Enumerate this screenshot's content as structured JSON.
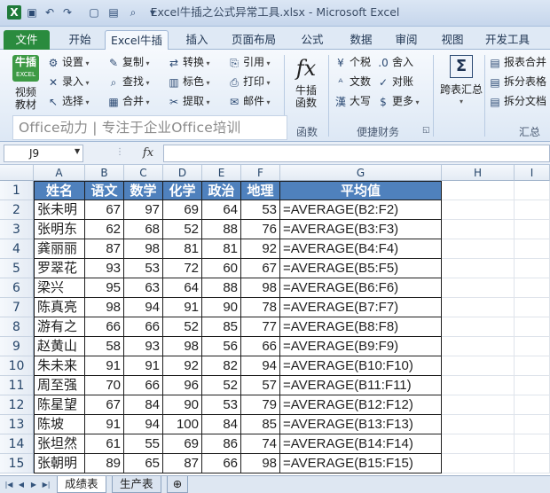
{
  "window": {
    "title": "Excel牛插之公式异常工具.xlsx - Microsoft Excel"
  },
  "quick_access": [
    {
      "icon": "excel-logo-icon",
      "glyph": "X"
    },
    {
      "icon": "save-icon",
      "glyph": "▣"
    },
    {
      "icon": "undo-icon",
      "glyph": "↶"
    },
    {
      "icon": "redo-icon",
      "glyph": "↷"
    },
    {
      "icon": "new-file-icon",
      "glyph": "▢"
    },
    {
      "icon": "open-folder-icon",
      "glyph": "▤"
    },
    {
      "icon": "print-preview-icon",
      "glyph": "⌕"
    },
    {
      "icon": "customize-icon",
      "glyph": "▾"
    }
  ],
  "tabs": [
    "文件",
    "开始",
    "Excel牛插",
    "插入",
    "页面布局",
    "公式",
    "数据",
    "审阅",
    "视图",
    "开发工具"
  ],
  "ribbon": {
    "niucha": {
      "logo_top": "牛插",
      "logo_sub": "EXCEL",
      "label": "视频\n教材"
    },
    "col1": [
      "设置",
      "录入",
      "选择"
    ],
    "col2": [
      "复制",
      "查找",
      "合并"
    ],
    "col3": [
      "转换",
      "标色",
      "提取"
    ],
    "col4": [
      "引用",
      "打印",
      "邮件"
    ],
    "func": {
      "label": "牛插\n函数",
      "glyph": "fx"
    },
    "col5": [
      "个税",
      "文数",
      "大写"
    ],
    "col6": [
      "舍入",
      "对账",
      "更多"
    ],
    "summary": {
      "label": "跨表汇总",
      "glyph": "Σ"
    },
    "col7": [
      "报表合并",
      "拆分表格",
      "拆分文档"
    ],
    "group_labels": {
      "func": "函数",
      "finance": "便捷财务",
      "summary": "汇总"
    },
    "banner": "Office动力 | 专注于企业Office培训"
  },
  "formula_bar": {
    "name_box": "J9",
    "fx": "fx",
    "formula": ""
  },
  "sheet": {
    "columns": [
      "A",
      "B",
      "C",
      "D",
      "E",
      "F",
      "G",
      "H",
      "I"
    ],
    "rows": [
      "1",
      "2",
      "3",
      "4",
      "5",
      "6",
      "7",
      "8",
      "9",
      "10",
      "11",
      "12",
      "13",
      "14",
      "15"
    ],
    "header": [
      "姓名",
      "语文",
      "数学",
      "化学",
      "政治",
      "地理",
      "平均值"
    ],
    "data": [
      [
        "张未明",
        "67",
        "97",
        "69",
        "64",
        "53",
        "=AVERAGE(B2:F2)"
      ],
      [
        "张明东",
        "62",
        "68",
        "52",
        "88",
        "76",
        "=AVERAGE(B3:F3)"
      ],
      [
        "龚丽丽",
        "87",
        "98",
        "81",
        "81",
        "92",
        "=AVERAGE(B4:F4)"
      ],
      [
        "罗翠花",
        "93",
        "53",
        "72",
        "60",
        "67",
        "=AVERAGE(B5:F5)"
      ],
      [
        "梁兴",
        "95",
        "63",
        "64",
        "88",
        "98",
        "=AVERAGE(B6:F6)"
      ],
      [
        "陈真亮",
        "98",
        "94",
        "91",
        "90",
        "78",
        "=AVERAGE(B7:F7)"
      ],
      [
        "游有之",
        "66",
        "66",
        "52",
        "85",
        "77",
        "=AVERAGE(B8:F8)"
      ],
      [
        "赵黄山",
        "58",
        "93",
        "98",
        "56",
        "66",
        "=AVERAGE(B9:F9)"
      ],
      [
        "朱未来",
        "91",
        "91",
        "92",
        "82",
        "94",
        "=AVERAGE(B10:F10)"
      ],
      [
        "周至强",
        "70",
        "66",
        "96",
        "52",
        "57",
        "=AVERAGE(B11:F11)"
      ],
      [
        "陈星望",
        "67",
        "84",
        "90",
        "53",
        "79",
        "=AVERAGE(B12:F12)"
      ],
      [
        "陈坡",
        "91",
        "94",
        "100",
        "84",
        "85",
        "=AVERAGE(B13:F13)"
      ],
      [
        "张坦然",
        "61",
        "55",
        "69",
        "86",
        "74",
        "=AVERAGE(B14:F14)"
      ],
      [
        "张朝明",
        "89",
        "65",
        "87",
        "66",
        "98",
        "=AVERAGE(B15:F15)"
      ]
    ]
  },
  "sheet_tabs": [
    "成绩表",
    "生产表"
  ],
  "colors": {
    "header_fill": "#4f81bd",
    "file_tab": "#2a8b3e"
  }
}
